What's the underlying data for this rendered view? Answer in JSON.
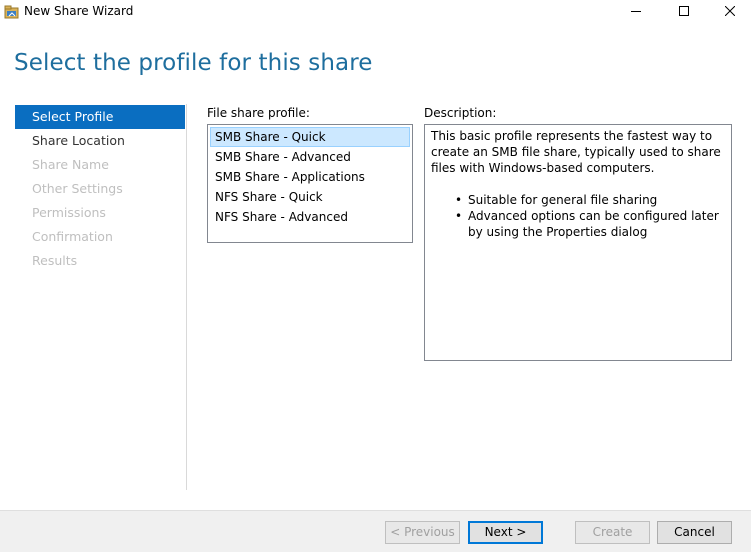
{
  "window": {
    "title": "New Share Wizard",
    "icons": {
      "app": "share-folder-icon",
      "minimize": "minimize-icon",
      "maximize": "maximize-icon",
      "close": "close-icon"
    }
  },
  "page": {
    "heading": "Select the profile for this share"
  },
  "steps": [
    {
      "label": "Select Profile",
      "state": "active"
    },
    {
      "label": "Share Location",
      "state": "enabled"
    },
    {
      "label": "Share Name",
      "state": "disabled"
    },
    {
      "label": "Other Settings",
      "state": "disabled"
    },
    {
      "label": "Permissions",
      "state": "disabled"
    },
    {
      "label": "Confirmation",
      "state": "disabled"
    },
    {
      "label": "Results",
      "state": "disabled"
    }
  ],
  "profile": {
    "label": "File share profile:",
    "items": [
      {
        "label": "SMB Share - Quick",
        "selected": true
      },
      {
        "label": "SMB Share - Advanced",
        "selected": false
      },
      {
        "label": "SMB Share - Applications",
        "selected": false
      },
      {
        "label": "NFS Share - Quick",
        "selected": false
      },
      {
        "label": "NFS Share - Advanced",
        "selected": false
      }
    ]
  },
  "description": {
    "label": "Description:",
    "text": "This basic profile represents the fastest way to create an SMB file share, typically used to share files with Windows-based computers.",
    "bullets": [
      "Suitable for general file sharing",
      "Advanced options can be configured later by using the Properties dialog"
    ]
  },
  "buttons": {
    "previous": "< Previous",
    "next": "Next >",
    "create": "Create",
    "cancel": "Cancel"
  },
  "colors": {
    "heading": "#1e6e9e",
    "active_step": "#0a6ec1",
    "selection": "#cce8ff",
    "default_button_border": "#0078d7"
  }
}
